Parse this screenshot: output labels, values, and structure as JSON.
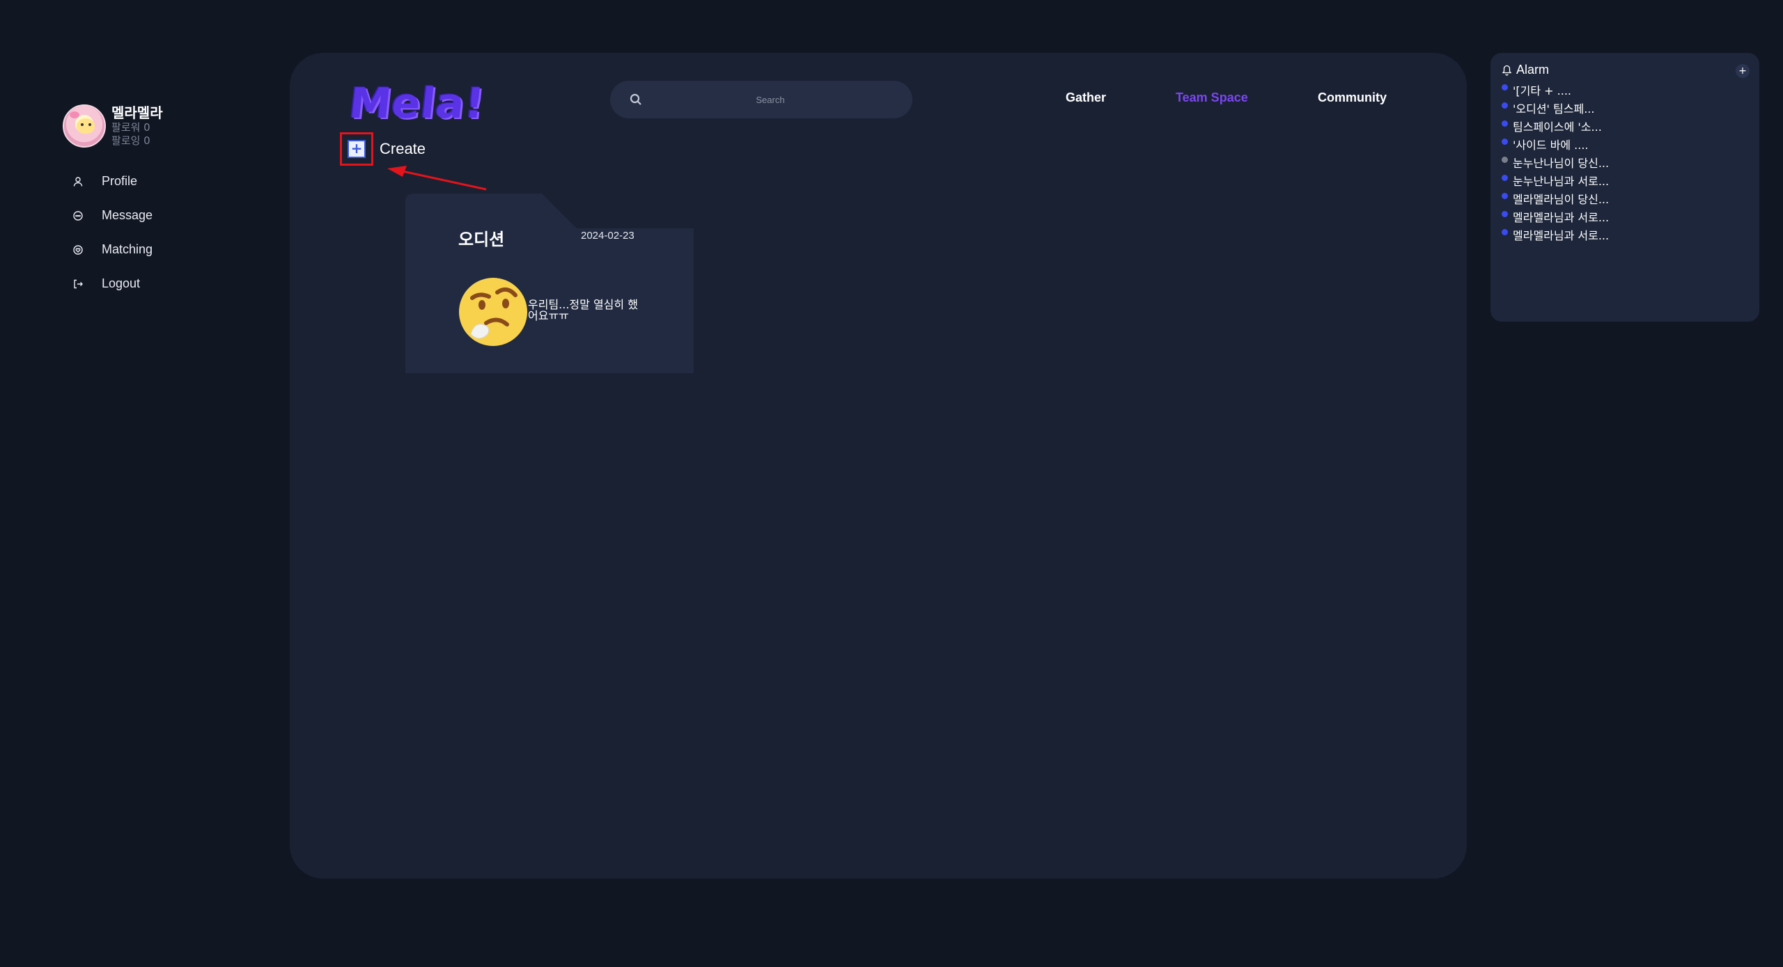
{
  "user": {
    "name": "멜라멜라",
    "followers": "팔로워 0",
    "following": "팔로잉 0"
  },
  "sidebar": {
    "items": [
      {
        "label": "Profile",
        "icon": "person-icon"
      },
      {
        "label": "Message",
        "icon": "chat-icon"
      },
      {
        "label": "Matching",
        "icon": "heart-icon"
      },
      {
        "label": "Logout",
        "icon": "logout-icon"
      }
    ]
  },
  "header": {
    "logo": "Mela!",
    "search_placeholder": "Search",
    "nav": {
      "gather": "Gather",
      "team_space": "Team Space",
      "community": "Community"
    },
    "active_nav": "Team Space",
    "active_color": "#7b46f0"
  },
  "main": {
    "create_label": "Create",
    "folder": {
      "title": "오디션",
      "date": "2024-02-23",
      "description": "우리팀...정말 열심히 했어요ㅠㅠ",
      "emoji": "thinking-face"
    }
  },
  "alarm": {
    "title": "Alarm",
    "add_label": "+",
    "items": [
      {
        "text": "'[기타 + ....",
        "color": "#3a4bf0"
      },
      {
        "text": "'오디션' 팀스페...",
        "color": "#3a4bf0"
      },
      {
        "text": "팀스페이스에 '소...",
        "color": "#3a4bf0"
      },
      {
        "text": "'사이드 바에 ....",
        "color": "#3a4bf0"
      },
      {
        "text": "눈누난나님이 당신...",
        "color": "#7a7f8c"
      },
      {
        "text": "눈누난나님과 서로...",
        "color": "#3a4bf0"
      },
      {
        "text": "멜라멜라님이 당신...",
        "color": "#3a4bf0"
      },
      {
        "text": "멜라멜라님과 서로...",
        "color": "#3a4bf0"
      },
      {
        "text": "멜라멜라님과 서로...",
        "color": "#3a4bf0"
      }
    ]
  }
}
